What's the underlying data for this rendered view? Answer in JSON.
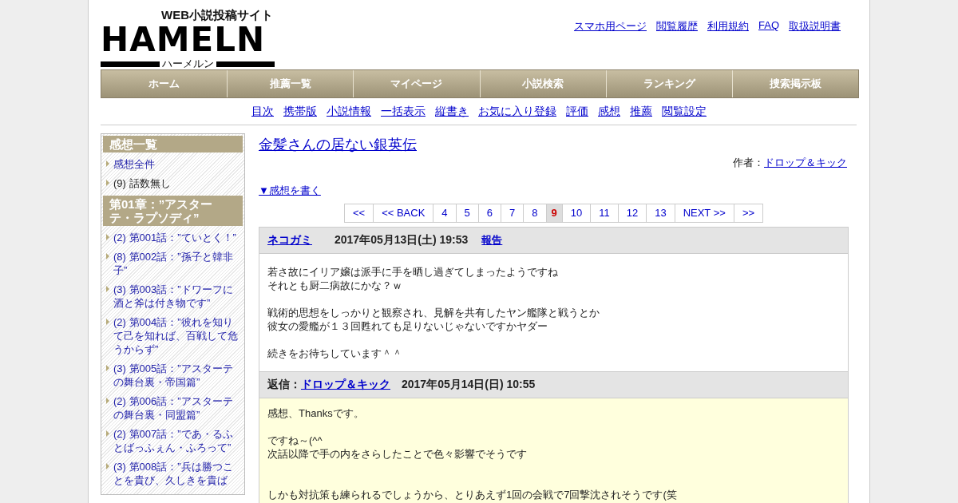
{
  "logo": {
    "tagline": "WEB小説投稿サイト",
    "wordmark": "HAMELN",
    "reading": "ハーメルン"
  },
  "top_links": [
    "スマホ用ページ",
    "閲覧履歴",
    "利用規約",
    "FAQ",
    "取扱説明書"
  ],
  "nav": [
    "ホーム",
    "推薦一覧",
    "マイページ",
    "小説検索",
    "ランキング",
    "捜索掲示板"
  ],
  "sub_nav": [
    "目次",
    "携帯版",
    "小説情報",
    "一括表示",
    "縦書き",
    "お気に入り登録",
    "評価",
    "感想",
    "推薦",
    "閲覧設定"
  ],
  "sidebar": [
    {
      "kind": "heading",
      "text": "感想一覧"
    },
    {
      "kind": "link",
      "text": "感想全件"
    },
    {
      "kind": "text",
      "text": "(9) 話数無し"
    },
    {
      "kind": "heading",
      "text": "第01章：”アスターテ・ラプソディ”"
    },
    {
      "kind": "link",
      "text": "(2) 第001話：”ていとく！”"
    },
    {
      "kind": "link",
      "text": "(8) 第002話：”孫子と韓非子”"
    },
    {
      "kind": "link",
      "text": "(3) 第003話：”ドワーフに酒と斧は付き物です”"
    },
    {
      "kind": "link",
      "text": "(2) 第004話：”彼れを知りて己を知れば、百戦して危うからず”"
    },
    {
      "kind": "link",
      "text": "(3) 第005話：”アスターテの舞台裏・帝国篇”"
    },
    {
      "kind": "link",
      "text": "(2) 第006話：”アスターテの舞台裏・同盟篇”"
    },
    {
      "kind": "link",
      "text": "(2) 第007話：”であ・るふとばっふぇん・ふろって”"
    },
    {
      "kind": "link",
      "text": "(3) 第008話：”兵は勝つことを貴び、久しきを貴ば"
    }
  ],
  "novel_title": "金髪さんの居ない銀英伝",
  "author_label": "作者：",
  "author": "ドロップ＆キック",
  "write_link": "▼感想を書く",
  "pagination": [
    {
      "label": "<<",
      "selected": false
    },
    {
      "label": "<< BACK",
      "selected": false
    },
    {
      "label": "4",
      "selected": false
    },
    {
      "label": "5",
      "selected": false
    },
    {
      "label": "6",
      "selected": false
    },
    {
      "label": "7",
      "selected": false
    },
    {
      "label": "8",
      "selected": false
    },
    {
      "label": "9",
      "selected": true
    },
    {
      "label": "10",
      "selected": false
    },
    {
      "label": "11",
      "selected": false
    },
    {
      "label": "12",
      "selected": false
    },
    {
      "label": "13",
      "selected": false
    },
    {
      "label": "NEXT >>",
      "selected": false
    },
    {
      "label": ">>",
      "selected": false
    }
  ],
  "comment": {
    "user": "ネコガミ",
    "date": "2017年05月13日(土) 19:53",
    "report": "報告",
    "body": [
      {
        "lines": [
          "若さ故にイリア嬢は派手に手を晒し過ぎてしまったようですね",
          "それとも厨二病故にかな？ｗ"
        ],
        "wide_gap": false
      },
      {
        "lines": [
          "戦術的思想をしっかりと観察され、見解を共有したヤン艦隊と戦うとか",
          "彼女の愛艦が１３回甦れても足りないじゃないですかヤダー"
        ],
        "wide_gap": false
      },
      {
        "lines": [
          "続きをお待ちしています＾＾"
        ],
        "wide_gap": false
      }
    ]
  },
  "reply": {
    "label": "返信：",
    "user": "ドロップ＆キック",
    "date": "2017年05月14日(日) 10:55",
    "body": [
      {
        "lines": [
          "感想、Thanksです。"
        ],
        "wide_gap": false
      },
      {
        "lines": [
          "ですね～(^^",
          "次話以降で手の内をさらしたことで色々影響でそうです"
        ],
        "wide_gap": false
      },
      {
        "lines": [
          "しかも対抗策も練られるでしょうから、とりあえず1回の会戦で7回撃沈されそうです(笑"
        ],
        "wide_gap": true
      }
    ]
  }
}
